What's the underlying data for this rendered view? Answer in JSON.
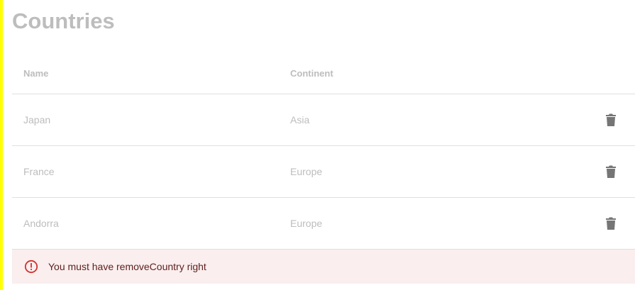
{
  "page": {
    "title": "Countries"
  },
  "table": {
    "columns": [
      "Name",
      "Continent"
    ],
    "rows": [
      {
        "name": "Japan",
        "continent": "Asia"
      },
      {
        "name": "France",
        "continent": "Europe"
      },
      {
        "name": "Andorra",
        "continent": "Europe"
      }
    ],
    "row_action_icon": "trash-icon"
  },
  "alert": {
    "icon": "error-outline-icon",
    "message": "You must have removeCountry right",
    "severity": "error"
  },
  "colors": {
    "accent_border": "#ffff00",
    "muted_text": "#bdbdbd",
    "delete_icon": "#757575",
    "alert_bg": "#faeeee",
    "alert_icon": "#d32f2f",
    "alert_text": "#5f2120"
  }
}
